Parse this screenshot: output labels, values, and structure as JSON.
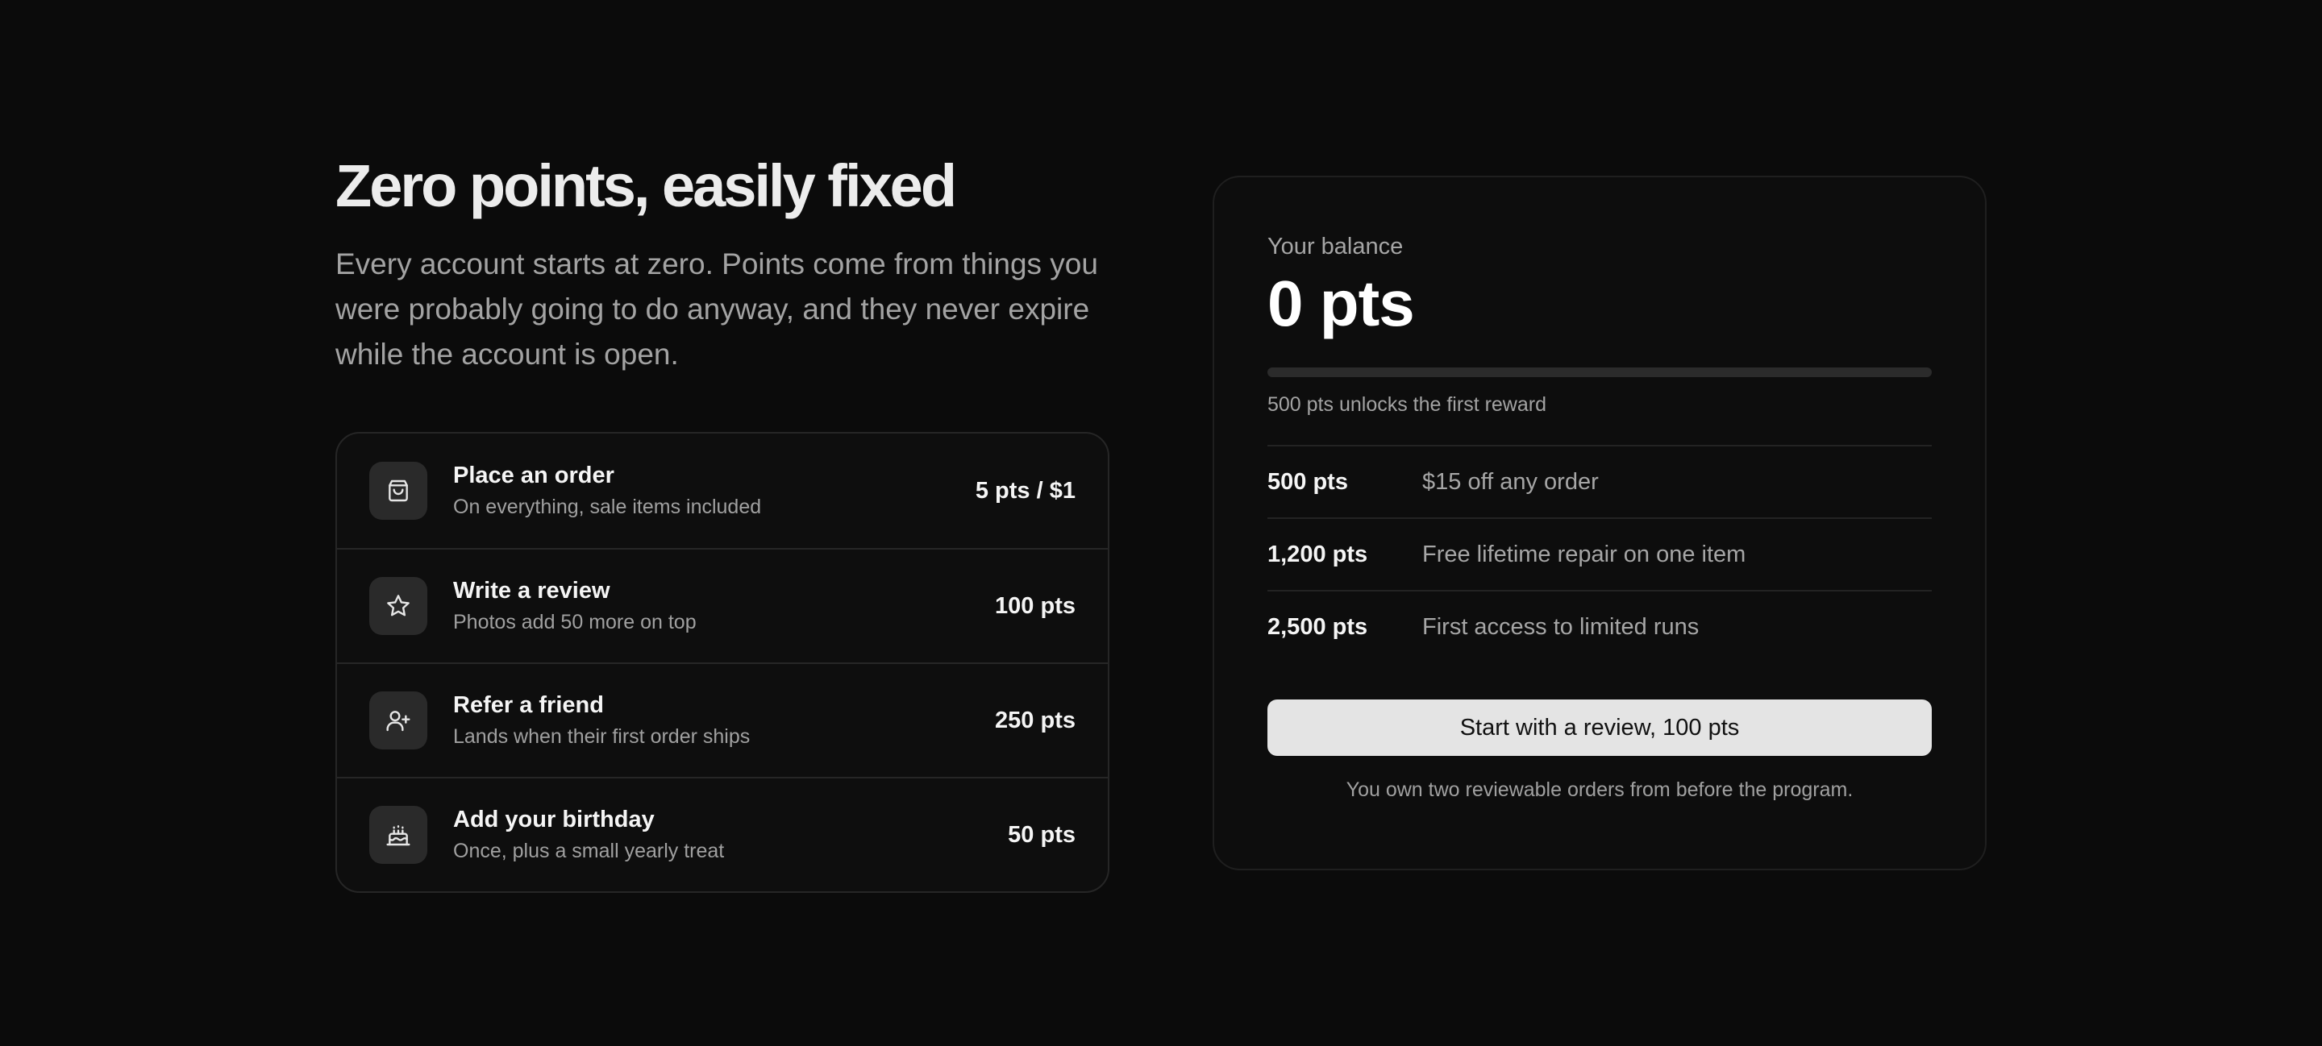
{
  "hero": {
    "title": "Zero points, easily fixed",
    "subtitle": "Every account starts at zero. Points come from things you were probably going to do anyway, and they never expire while the account is open."
  },
  "earn_ways": [
    {
      "icon": "shopping-bag-icon",
      "title": "Place an order",
      "desc": "On everything, sale items included",
      "points": "5 pts / $1"
    },
    {
      "icon": "star-icon",
      "title": "Write a review",
      "desc": "Photos add 50 more on top",
      "points": "100 pts"
    },
    {
      "icon": "user-plus-icon",
      "title": "Refer a friend",
      "desc": "Lands when their first order ships",
      "points": "250 pts"
    },
    {
      "icon": "cake-icon",
      "title": "Add your birthday",
      "desc": "Once, plus a small yearly treat",
      "points": "50 pts"
    }
  ],
  "balance": {
    "label": "Your balance",
    "value": "0 pts",
    "progress_fraction": 0,
    "unlock_text": "500 pts unlocks the first reward"
  },
  "tiers": [
    {
      "points": "500 pts",
      "reward": "$15 off any order"
    },
    {
      "points": "1,200 pts",
      "reward": "Free lifetime repair on one item"
    },
    {
      "points": "2,500 pts",
      "reward": "First access to limited runs"
    }
  ],
  "cta": {
    "label": "Start with a review, 100 pts",
    "footnote": "You own two reviewable orders from before the program."
  },
  "colors": {
    "background": "#0b0b0b",
    "card_border": "#262626",
    "button_bg": "#e4e4e4",
    "muted_text": "#a3a3a3"
  }
}
